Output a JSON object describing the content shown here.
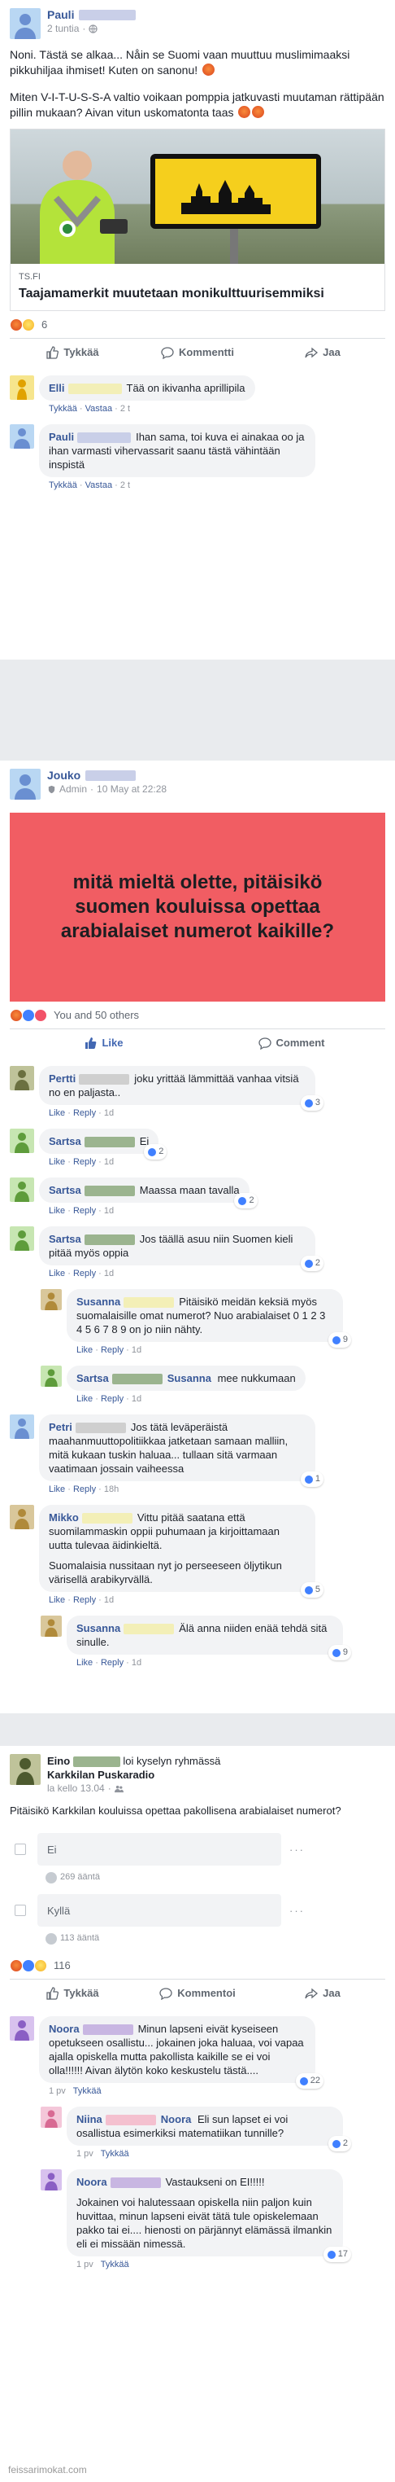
{
  "post1": {
    "author": "Pauli",
    "time": "2 tuntia",
    "text_p1": "Noni. Tästä se alkaa... Nåin se Suomi vaan muuttuu muslimimaaksi pikkuhiljaa ihmiset! Kuten on sanonu!",
    "text_p2": "Miten V-I-T-U-S-S-A valtio voikaan pomppia jatkuvasti muutaman rättipään pillin mukaan? Aivan vitun uskomatonta taas",
    "link_domain": "TS.FI",
    "link_title": "Taajamamerkit muutetaan monikulttuurisemmiksi",
    "reaction_count": "6",
    "action_like": "Tykkää",
    "action_comment": "Kommentti",
    "action_share": "Jaa",
    "comments": [
      {
        "name": "Elli",
        "text": "Tää on ikivanha aprillipila",
        "meta_like": "Tykkää",
        "meta_reply": "Vastaa",
        "meta_time": "2 t"
      },
      {
        "name": "Pauli",
        "text": "Ihan sama, toi kuva ei ainakaa oo ja ihan varmasti vihervassarit saanu tästä vähintään inspistä",
        "meta_like": "Tykkää",
        "meta_reply": "Vastaa",
        "meta_time": "2 t"
      }
    ]
  },
  "post2": {
    "author": "Jouko",
    "role": "Admin",
    "time": "10 May at 22:28",
    "poster_text": "mitä mieltä olette, pitäisikö suomen kouluissa opettaa arabialaiset numerot kaikille?",
    "reactions_text": "You and 50 others",
    "action_like": "Like",
    "action_comment": "Comment",
    "comments": [
      {
        "name": "Pertti",
        "text": "joku yrittää lämmittää vanhaa vitsiä no en paljasta..",
        "like": "Like",
        "reply": "Reply",
        "time": "1d",
        "react": "3"
      },
      {
        "name": "Sartsa",
        "text": "Ei",
        "like": "Like",
        "reply": "Reply",
        "time": "1d",
        "react": "2"
      },
      {
        "name": "Sartsa",
        "text": "Maassa maan tavalla",
        "like": "Like",
        "reply": "Reply",
        "time": "1d",
        "react": "2"
      },
      {
        "name": "Sartsa",
        "text": "Jos täällä asuu niin Suomen kieli pitää myös oppia",
        "like": "Like",
        "reply": "Reply",
        "time": "1d",
        "react": "2"
      },
      {
        "name": "Susanna",
        "text": "Pitäisikö meidän keksiä myös suomalaisille omat numerot? Nuo arabialaiset 0 1 2 3 4 5 6 7 8 9 on jo niin nähty.",
        "like": "Like",
        "reply": "Reply",
        "time": "1d",
        "react": "9",
        "reply_level": true
      },
      {
        "name": "Sartsa",
        "mention": "Susanna",
        "text": "mee nukkumaan",
        "like": "Like",
        "reply": "Reply",
        "time": "1d",
        "reply_level": true
      },
      {
        "name": "Petri",
        "text": "Jos tätä leväperäistä maahanmuuttopolitiikkaa jatketaan samaan malliin, mitä kukaan tuskin haluaa... tullaan sitä varmaan vaatimaan jossain vaiheessa",
        "like": "Like",
        "reply": "Reply",
        "time": "18h",
        "react": "1"
      },
      {
        "name": "Mikko",
        "text": "Vittu pitää saatana että suomilammaskin oppii puhumaan ja kirjoittamaan uutta tulevaa äidinkieltä.",
        "text2": "Suomalaisia nussitaan nyt jo perseeseen öljytikun värisellä arabikyrvällä.",
        "like": "Like",
        "reply": "Reply",
        "time": "1d",
        "react": "5"
      },
      {
        "name": "Susanna",
        "text": "Älä anna niiden enää tehdä sitä sinulle.",
        "like": "Like",
        "reply": "Reply",
        "time": "1d",
        "react": "9",
        "reply_level": true
      }
    ]
  },
  "post3": {
    "author": "Eino",
    "action_text": "loi kyselyn ryhmässä",
    "group": "Karkkilan Puskaradio",
    "time": "la kello 13.04",
    "question": "Pitäisikö Karkkilan kouluissa opettaa pakollisena arabialaiset numerot?",
    "options": [
      {
        "label": "Ei",
        "votes": "269 ääntä"
      },
      {
        "label": "Kyllä",
        "votes": "113 ääntä"
      }
    ],
    "reaction_count": "116",
    "action_like": "Tykkää",
    "action_comment": "Kommentoi",
    "action_share": "Jaa",
    "comments": [
      {
        "name": "Noora",
        "text": "Minun lapseni eivät kyseiseen opetukseen osallistu... jokainen joka haluaa, voi vapaa ajalla opiskella mutta pakollista kaikille se ei voi olla!!!!!! Aivan älytön koko keskustelu tästä....",
        "time": "1 pv",
        "like": "Tykkää",
        "react": "22"
      },
      {
        "name": "Niina",
        "mention": "Noora",
        "text": "Eli sun lapset ei voi osallistua esimerkiksi matematiikan tunnille?",
        "time": "1 pv",
        "like": "Tykkää",
        "react": "2",
        "reply_level": true
      },
      {
        "name": "Noora",
        "text": "Vastaukseni on EI!!!!!",
        "text2": "Jokainen voi halutessaan opiskella niin paljon kuin huvittaa, minun lapseni eivät tätä tule opiskelemaan pakko tai ei.... hienosti on pärjännyt elämässä ilmankin eli ei missään nimessä.",
        "time": "1 pv",
        "like": "Tykkää",
        "react": "17",
        "reply_level": true
      }
    ]
  },
  "watermark": "feissarimokat.com"
}
